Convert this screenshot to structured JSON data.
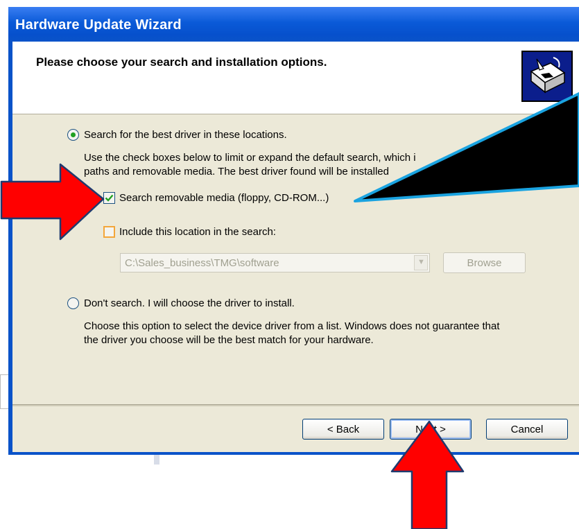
{
  "window": {
    "title": "Hardware Update Wizard"
  },
  "header": {
    "title": "Please choose your search and installation options."
  },
  "options": {
    "search": {
      "label": "Search for the best driver in these locations.",
      "selected": true,
      "description_line1": "Use the check boxes below to limit or expand the default search, which i",
      "description_line2": "paths and removable media. The best driver found will be installed"
    },
    "removable_media": {
      "label": "Search removable media (floppy, CD-ROM...)",
      "checked": true
    },
    "include_location": {
      "label": "Include this location in the search:",
      "checked": false
    },
    "location_path": "C:\\Sales_business\\TMG\\software",
    "browse_label": "Browse",
    "dont_search": {
      "label": "Don't search. I will choose the driver to install.",
      "selected": false,
      "description_line1": "Choose this option to select the device driver from a list.  Windows does not guarantee that",
      "description_line2": "the driver you choose will be the best match for your hardware."
    }
  },
  "buttons": {
    "back": "< Back",
    "next": "Next >",
    "cancel": "Cancel"
  },
  "colors": {
    "title_blue": "#0a53c9",
    "annotation_red": "#ff0000",
    "callout_border": "#1aa3e0"
  },
  "icons": {
    "wizard": "hardware-wizard-icon"
  }
}
